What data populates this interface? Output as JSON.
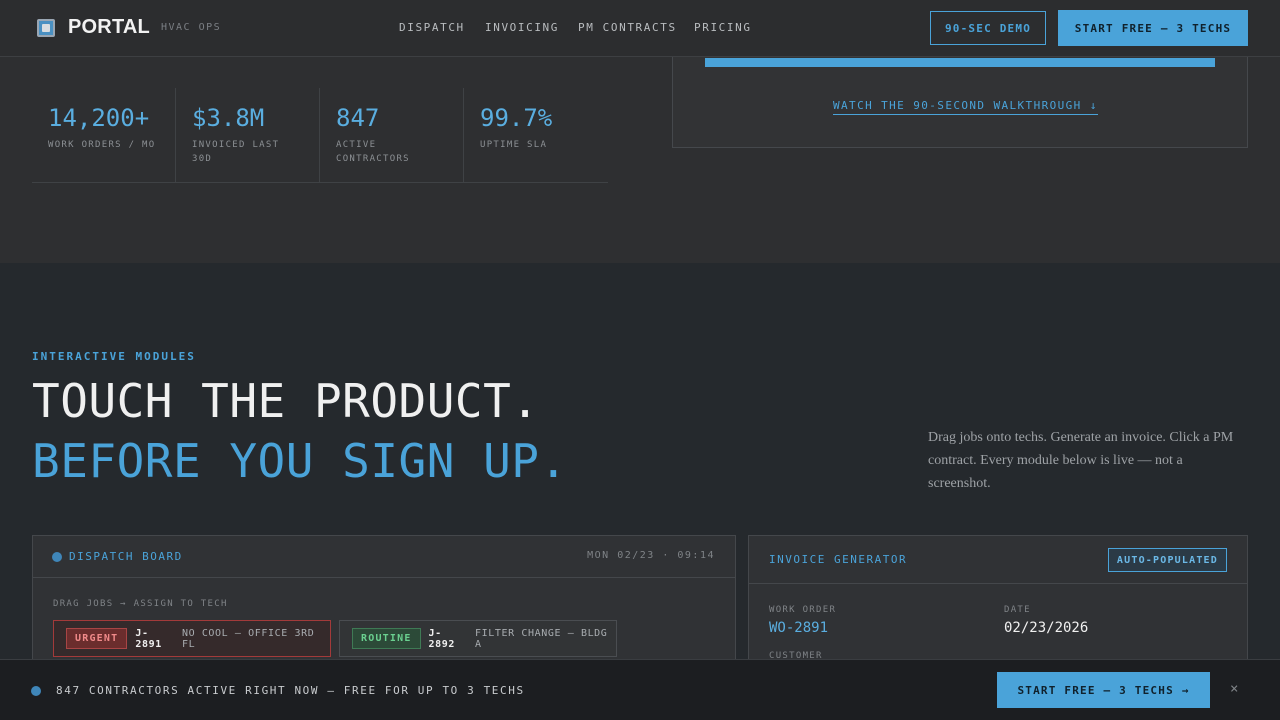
{
  "header": {
    "brand": "PORTAL",
    "brand_sub": "HVAC OPS",
    "nav": [
      "DISPATCH",
      "INVOICING",
      "PM CONTRACTS",
      "PRICING"
    ],
    "demo_button": "90-SEC DEMO",
    "start_button": "START FREE — 3 TECHS"
  },
  "stats": [
    {
      "value": "14,200+",
      "label": "WORK ORDERS / MO"
    },
    {
      "value": "$3.8M",
      "label": "INVOICED LAST 30D"
    },
    {
      "value": "847",
      "label": "ACTIVE CONTRACTORS"
    },
    {
      "value": "99.7%",
      "label": "UPTIME SLA"
    }
  ],
  "video": {
    "link": "WATCH THE 90-SECOND WALKTHROUGH ↓"
  },
  "section": {
    "eyebrow": "INTERACTIVE MODULES",
    "title_line1": "TOUCH THE PRODUCT.",
    "title_line2": "BEFORE YOU SIGN UP.",
    "description": "Drag jobs onto techs. Generate an invoice. Click a PM contract. Every module below is live — not a screenshot."
  },
  "dispatch": {
    "title": "DISPATCH BOARD",
    "time": "MON 02/23 · 09:14",
    "hint": "DRAG JOBS → ASSIGN TO TECH",
    "jobs": [
      {
        "tag": "URGENT",
        "id": "J-2891",
        "desc": "NO COOL — OFFICE 3RD FL"
      },
      {
        "tag": "ROUTINE",
        "id": "J-2892",
        "desc": "FILTER CHANGE — BLDG A"
      }
    ]
  },
  "invoice": {
    "title": "INVOICE GENERATOR",
    "badge": "AUTO-POPULATED",
    "work_order_label": "WORK ORDER",
    "work_order_value": "WO-2891",
    "date_label": "DATE",
    "date_value": "02/23/2026",
    "customer_label": "CUSTOMER"
  },
  "bottom_bar": {
    "text": "847 CONTRACTORS ACTIVE RIGHT NOW — FREE FOR UP TO 3 TECHS",
    "button": "START FREE — 3 TECHS →",
    "close": "×"
  },
  "colors": {
    "accent": "#4aa3d9",
    "urgent": "#a84545",
    "routine": "#3f7a55",
    "background": "#25292d"
  }
}
